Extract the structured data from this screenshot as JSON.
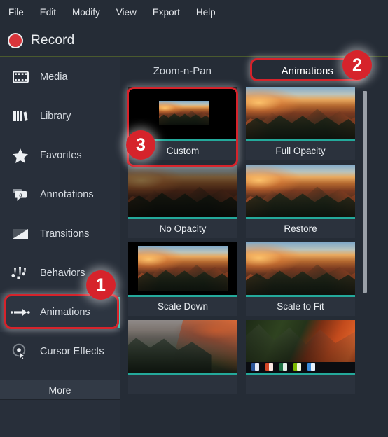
{
  "app": {
    "accent_teal": "#24a99b",
    "annotation_red": "#d6232b",
    "record_red": "#d8343a",
    "panel_bg": "#252c36",
    "sidebar_bg": "#282f3a"
  },
  "menubar": {
    "items": [
      {
        "label": "File"
      },
      {
        "label": "Edit"
      },
      {
        "label": "Modify"
      },
      {
        "label": "View"
      },
      {
        "label": "Export"
      },
      {
        "label": "Help"
      }
    ]
  },
  "recordbar": {
    "icon": "record-dot-icon",
    "label": "Record"
  },
  "sidebar": {
    "items": [
      {
        "label": "Media",
        "icon": "film-strip-icon",
        "active": false
      },
      {
        "label": "Library",
        "icon": "books-icon",
        "active": false
      },
      {
        "label": "Favorites",
        "icon": "star-icon",
        "active": false
      },
      {
        "label": "Annotations",
        "icon": "callout-a-icon",
        "active": false
      },
      {
        "label": "Transitions",
        "icon": "transition-icon",
        "active": false
      },
      {
        "label": "Behaviors",
        "icon": "behaviors-icon",
        "active": false
      },
      {
        "label": "Animations",
        "icon": "arrow-right-icon",
        "active": true
      },
      {
        "label": "Cursor Effects",
        "icon": "cursor-circle-icon",
        "active": false
      }
    ],
    "more_label": "More"
  },
  "content": {
    "tabs": [
      {
        "label": "Zoom-n-Pan",
        "selected": false
      },
      {
        "label": "Animations",
        "selected": true
      }
    ],
    "grid": [
      {
        "label": "Custom",
        "thumb_style": "letterbox-small",
        "selected": true
      },
      {
        "label": "Full Opacity",
        "thumb_style": "sunset",
        "selected": false
      },
      {
        "label": "No Opacity",
        "thumb_style": "dark",
        "selected": false
      },
      {
        "label": "Restore",
        "thumb_style": "sunset",
        "selected": false
      },
      {
        "label": "Scale Down",
        "thumb_style": "letterbox-large",
        "selected": false
      },
      {
        "label": "Scale to Fit",
        "thumb_style": "sunset",
        "selected": false
      },
      {
        "label": "",
        "thumb_style": "cold",
        "selected": false
      },
      {
        "label": "",
        "thumb_style": "green-taskbar",
        "selected": false
      }
    ]
  },
  "annotations": {
    "badges": [
      {
        "number": "1",
        "target": "sidebar-item-animations"
      },
      {
        "number": "2",
        "target": "tab-animations"
      },
      {
        "number": "3",
        "target": "grid-item-custom"
      }
    ]
  },
  "scrollbar": {
    "orientation": "vertical"
  }
}
